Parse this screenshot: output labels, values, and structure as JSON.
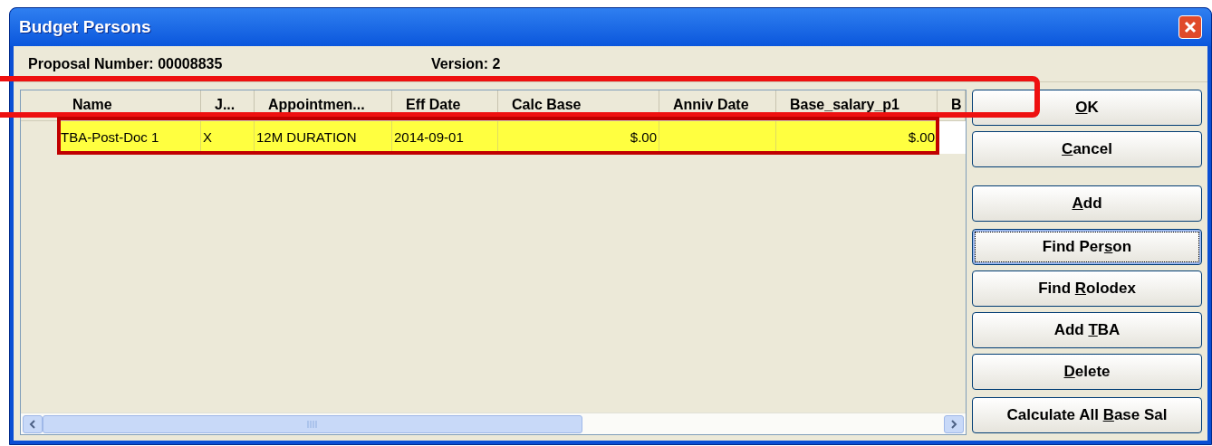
{
  "window": {
    "title": "Budget Persons"
  },
  "proposal": {
    "label": "Proposal Number:",
    "value": "00008835"
  },
  "version": {
    "label": "Version:",
    "value": "2"
  },
  "table": {
    "columns": [
      {
        "label": "Name"
      },
      {
        "label": "J..."
      },
      {
        "label": "Appointmen..."
      },
      {
        "label": "Eff Date"
      },
      {
        "label": "Calc Base"
      },
      {
        "label": "Anniv Date"
      },
      {
        "label": "Base_salary_p1"
      },
      {
        "label": "B"
      }
    ],
    "rows": [
      {
        "selected": true,
        "cells": [
          "TBA-Post-Doc 1",
          "X",
          "12M DURATION",
          "2014-09-01",
          "$.00",
          "",
          "$.00"
        ]
      }
    ]
  },
  "buttons": [
    {
      "label": "OK",
      "focused": false
    },
    {
      "label": "Cancel",
      "focused": false
    },
    {
      "label": "Add",
      "focused": false
    },
    {
      "label": "Find Person",
      "focused": true
    },
    {
      "label": "Find Rolodex",
      "focused": false
    },
    {
      "label": "Add TBA",
      "focused": false
    },
    {
      "label": "Delete",
      "focused": false
    },
    {
      "label": "Calculate All Base Sal",
      "focused": false
    }
  ]
}
